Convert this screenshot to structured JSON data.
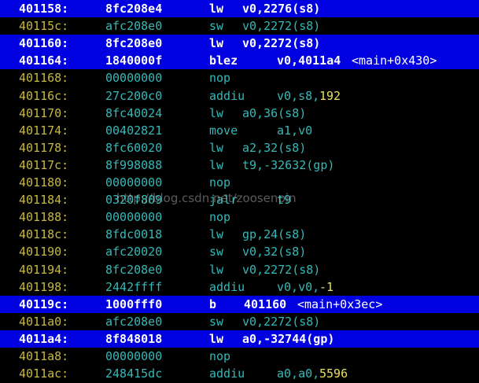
{
  "colors": {
    "background": "#000000",
    "highlight_bar": "#0000e0",
    "address": "#c8b840",
    "instruction": "#36b8b8",
    "immediate": "#e8e060",
    "highlight_text": "#ffffff"
  },
  "rows": [
    {
      "addr": "401158:",
      "hex": "8fc208e4",
      "mn": "lw",
      "ops": "v0,2276(s8)",
      "hl": true
    },
    {
      "addr": "40115c:",
      "hex": "afc208e0",
      "mn": "sw",
      "ops": "v0,2272(s8)",
      "hl": false
    },
    {
      "addr": "401160:",
      "hex": "8fc208e0",
      "mn": "lw",
      "ops": "v0,2272(s8)",
      "hl": true
    },
    {
      "addr": "401164:",
      "hex": "1840000f",
      "mn": "blez",
      "ops": "v0,4011a4",
      "sym": "<main+0x430>",
      "hl": true
    },
    {
      "addr": "401168:",
      "hex": "00000000",
      "mn": "nop",
      "ops": "",
      "hl": false
    },
    {
      "addr": "40116c:",
      "hex": "27c200c0",
      "mn": "addiu",
      "ops": "v0,s8,",
      "imm": "192",
      "hl": false
    },
    {
      "addr": "401170:",
      "hex": "8fc40024",
      "mn": "lw",
      "ops": "a0,36(s8)",
      "hl": false
    },
    {
      "addr": "401174:",
      "hex": "00402821",
      "mn": "move",
      "ops": "a1,v0",
      "hl": false
    },
    {
      "addr": "401178:",
      "hex": "8fc60020",
      "mn": "lw",
      "ops": "a2,32(s8)",
      "hl": false
    },
    {
      "addr": "40117c:",
      "hex": "8f998088",
      "mn": "lw",
      "ops": "t9,-32632(gp)",
      "hl": false
    },
    {
      "addr": "401180:",
      "hex": "00000000",
      "mn": "nop",
      "ops": "",
      "hl": false
    },
    {
      "addr": "401184:",
      "hex": "0320f809",
      "mn": "jalr",
      "ops": "t9",
      "hl": false
    },
    {
      "addr": "401188:",
      "hex": "00000000",
      "mn": "nop",
      "ops": "",
      "hl": false
    },
    {
      "addr": "40118c:",
      "hex": "8fdc0018",
      "mn": "lw",
      "ops": "gp,24(s8)",
      "hl": false
    },
    {
      "addr": "401190:",
      "hex": "afc20020",
      "mn": "sw",
      "ops": "v0,32(s8)",
      "hl": false
    },
    {
      "addr": "401194:",
      "hex": "8fc208e0",
      "mn": "lw",
      "ops": "v0,2272(s8)",
      "hl": false
    },
    {
      "addr": "401198:",
      "hex": "2442ffff",
      "mn": "addiu",
      "ops": "v0,v0,",
      "imm": "-1",
      "hl": false
    },
    {
      "addr": "40119c:",
      "hex": "1000fff0",
      "mn": "b",
      "ops": "401160",
      "sym": "<main+0x3ec>",
      "hl": true
    },
    {
      "addr": "4011a0:",
      "hex": "afc208e0",
      "mn": "sw",
      "ops": "v0,2272(s8)",
      "hl": false
    },
    {
      "addr": "4011a4:",
      "hex": "8f848018",
      "mn": "lw",
      "ops": "a0,-32744(gp)",
      "hl": true
    },
    {
      "addr": "4011a8:",
      "hex": "00000000",
      "mn": "nop",
      "ops": "",
      "hl": false
    },
    {
      "addr": "4011ac:",
      "hex": "248415dc",
      "mn": "addiu",
      "ops": "a0,a0,",
      "imm": "5596",
      "hl": false
    }
  ],
  "watermark": "http://blog.csdn.net/zoosenpin"
}
